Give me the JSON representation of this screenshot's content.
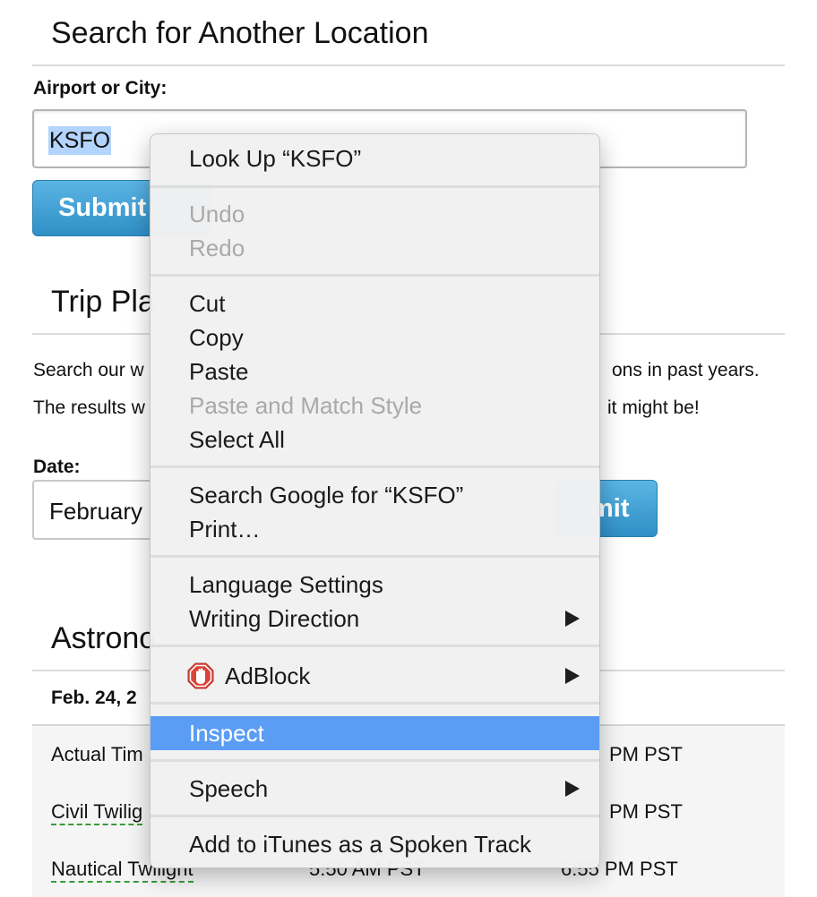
{
  "search": {
    "heading": "Search for Another Location",
    "field_label": "Airport or City:",
    "value": "KSFO",
    "submit_label": "Submit"
  },
  "trip": {
    "heading": "Trip Pla",
    "line1_left": "Search our w",
    "line1_right": "ons in past years.",
    "line2_left": "The results w",
    "line2_right": "it might be!",
    "date_label": "Date:",
    "date_value": "February",
    "submit_label": "mit"
  },
  "astronomy": {
    "heading": "Astrono",
    "date_header": "Feb. 24, 2",
    "rows": [
      {
        "name": "Actual Tim",
        "rise": "",
        "set": "PM PST"
      },
      {
        "name": "Civil Twilig",
        "rise": "",
        "set": "PM PST"
      },
      {
        "name": "Nautical Twilight",
        "rise": "5:50 AM PST",
        "set": "6:55 PM PST"
      }
    ]
  },
  "context_menu": {
    "look_up": "Look Up “KSFO”",
    "undo": "Undo",
    "redo": "Redo",
    "cut": "Cut",
    "copy": "Copy",
    "paste": "Paste",
    "paste_match": "Paste and Match Style",
    "select_all": "Select All",
    "search_google": "Search Google for “KSFO”",
    "print": "Print…",
    "language_settings": "Language Settings",
    "writing_direction": "Writing Direction",
    "adblock": "AdBlock",
    "inspect": "Inspect",
    "speech": "Speech",
    "add_itunes": "Add to iTunes as a Spoken Track"
  },
  "colors": {
    "highlight": "#5b9df4",
    "button": "#3a9fd6",
    "selection": "#b3d4fc"
  }
}
